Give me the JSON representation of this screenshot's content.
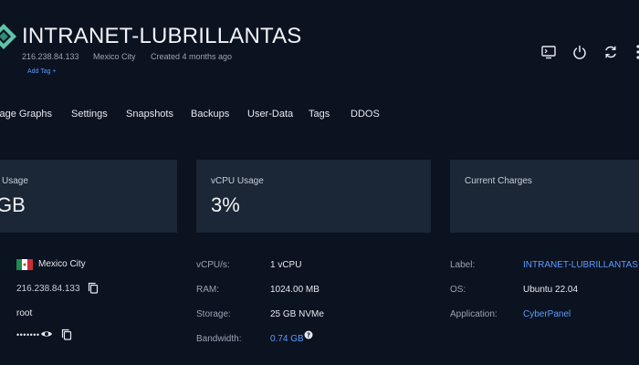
{
  "server": {
    "name": "INTRANET-LUBRILLANTAS",
    "ip": "216.238.84.133",
    "location": "Mexico City",
    "created": "Created 4 months ago",
    "add_tag": "Add Tag +"
  },
  "header_icons": [
    "console-icon",
    "power-icon",
    "restart-icon",
    "more-icon"
  ],
  "tabs": [
    "sage Graphs",
    "Settings",
    "Snapshots",
    "Backups",
    "User-Data",
    "Tags",
    "DDOS"
  ],
  "cards": [
    {
      "label": "Usage",
      "value": "GB"
    },
    {
      "label": "vCPU Usage",
      "value": "3%"
    },
    {
      "label": "Current Charges",
      "value": ""
    }
  ],
  "left_info": {
    "location": "Mexico City",
    "ip": "216.238.84.133",
    "user": "root",
    "password_mask": "•••••••"
  },
  "specs": [
    {
      "label": "vCPU/s:",
      "value": "1 vCPU"
    },
    {
      "label": "RAM:",
      "value": "1024.00 MB"
    },
    {
      "label": "Storage:",
      "value": "25 GB NVMe"
    },
    {
      "label": "Bandwidth:",
      "value": "0.74 GB"
    }
  ],
  "details": [
    {
      "label": "Label:",
      "value": "INTRANET-LUBRILLANTAS"
    },
    {
      "label": "OS:",
      "value": "Ubuntu 22.04"
    },
    {
      "label": "Application:",
      "value": "CyberPanel"
    }
  ],
  "colors": {
    "background": "#0b1220",
    "card": "#1b2636",
    "link": "#5b9bff",
    "logo": "#3aa58f"
  }
}
